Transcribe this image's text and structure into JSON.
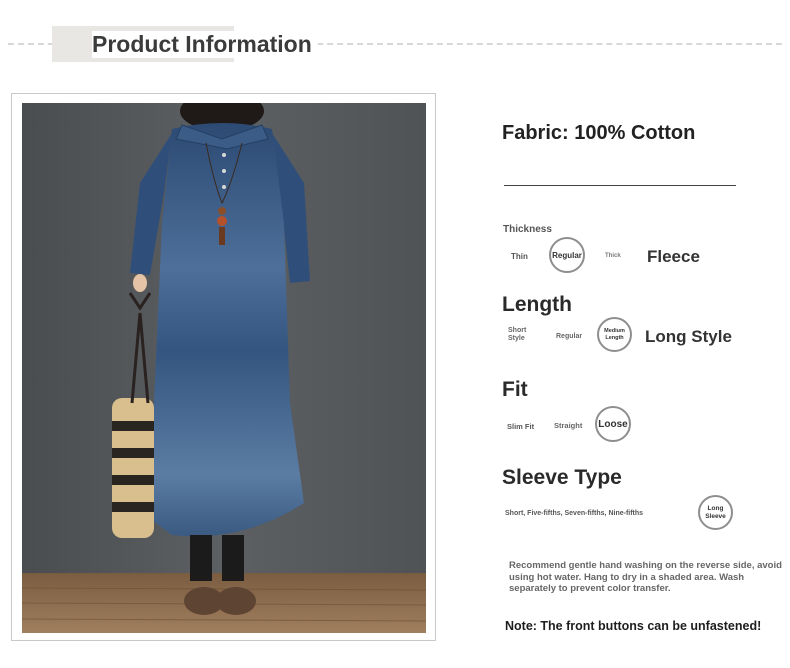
{
  "header": {
    "title": "Product Information"
  },
  "fabric": {
    "label": "Fabric: 100% Cotton"
  },
  "thickness": {
    "heading": "Thickness",
    "options": [
      "Thin",
      "Regular",
      "Thick"
    ],
    "selected_label": "Fleece"
  },
  "length": {
    "heading": "Length",
    "options": [
      "Short Style",
      "Regular",
      "Medium Length"
    ],
    "selected_label": "Long Style"
  },
  "fit": {
    "heading": "Fit",
    "options": [
      "Slim Fit",
      "Straight",
      "Loose"
    ]
  },
  "sleeve": {
    "heading": "Sleeve Type",
    "options_text": "Short, Five-fifths, Seven-fifths, Nine-fifths",
    "selected": "Long Sleeve"
  },
  "care": {
    "text": "Recommend gentle hand washing on the reverse side, avoid using hot water. Hang to dry in a shaded area. Wash separately to prevent color transfer."
  },
  "note": {
    "text": "Note: The front buttons can be unfastened!"
  },
  "colors": {
    "denim": "#2f4f7a",
    "wall": "#535658",
    "floor": "#8a6a4c"
  }
}
